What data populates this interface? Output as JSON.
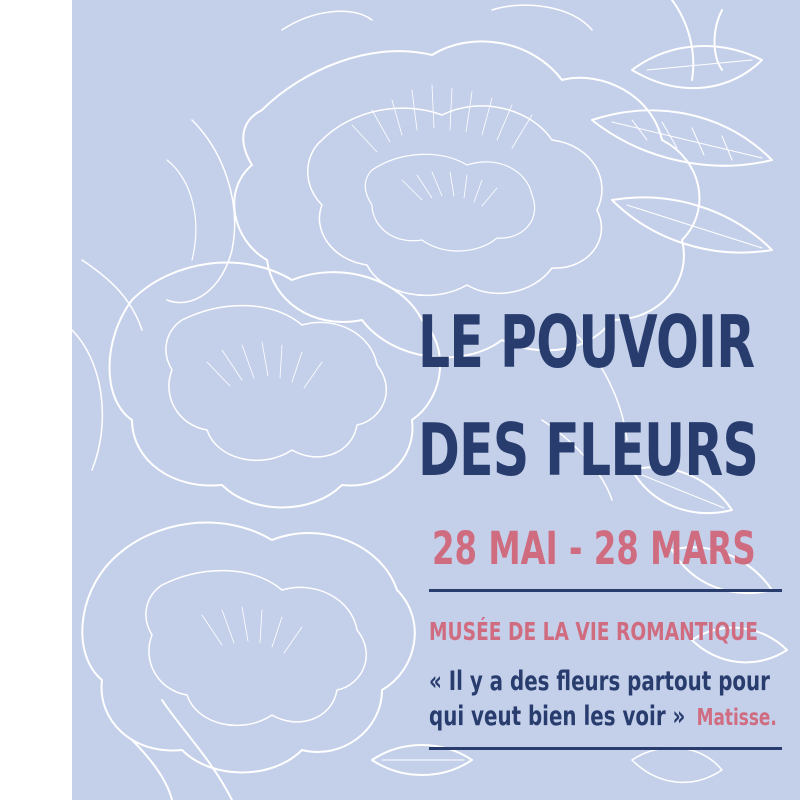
{
  "poster": {
    "title_line_1": "LE POUVOIR",
    "title_line_2": "DES FLEURS",
    "dates": "28 MAI - 28 MARS",
    "museum": "MUSÉE DE LA VIE ROMANTIQUE",
    "quote": {
      "open_mark": "«",
      "line_1": "Il y a des fleurs partout pour",
      "line_2": "qui veut bien les voir",
      "close_mark": "»",
      "author": "Matisse."
    }
  },
  "colors": {
    "background_panel": "#c4cfea",
    "title": "#283d6e",
    "accent": "#d06c80",
    "line_art": "#ffffff"
  },
  "illustration": "white-line-peony-flower-icon"
}
